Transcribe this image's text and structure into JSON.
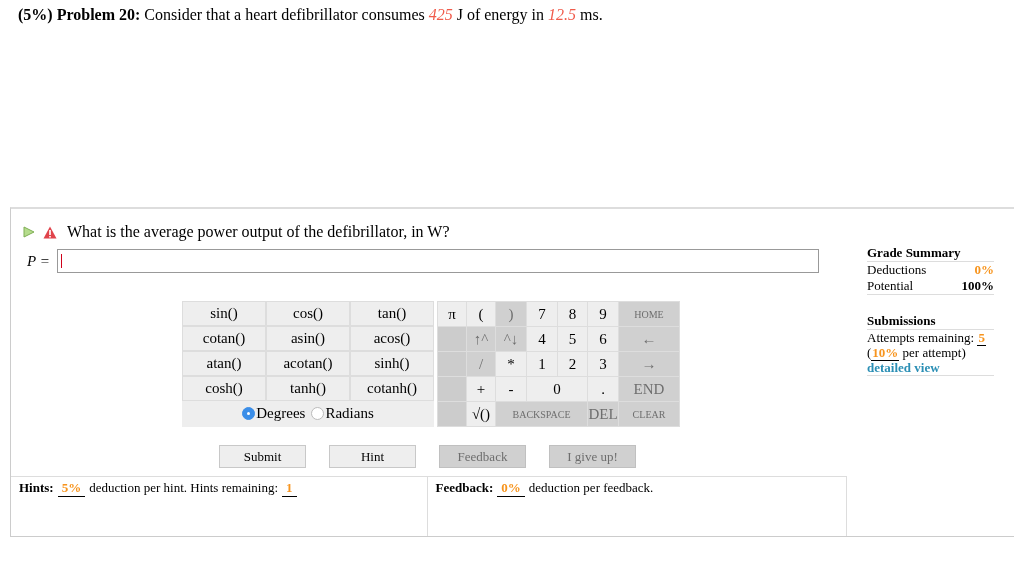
{
  "problem": [
    {
      "kind": "label",
      "text": "(5%) Problem 20:"
    },
    {
      "kind": "plain",
      "text": "Consider that a heart defibrillator consumes"
    },
    {
      "kind": "value",
      "text": "425"
    },
    {
      "kind": "plain",
      "text": "J of energy in"
    },
    {
      "kind": "value",
      "text": "12.5"
    },
    {
      "kind": "plain",
      "text": "ms."
    }
  ],
  "question": {
    "text": "What is the average power output of the defibrillator, in W?",
    "variable": "P ="
  },
  "functions": [
    [
      "sin()",
      "cos()",
      "tan()"
    ],
    [
      "cotan()",
      "asin()",
      "acos()"
    ],
    [
      "atan()",
      "acotan()",
      "sinh()"
    ],
    [
      "cosh()",
      "tanh()",
      "cotanh()"
    ]
  ],
  "angle_modes": [
    {
      "label": "Degrees",
      "selected": true
    },
    {
      "label": "Radians",
      "selected": false
    }
  ],
  "keypad": [
    [
      {
        "kind": "key",
        "label": "π",
        "disabled": false
      },
      {
        "kind": "key",
        "label": "(",
        "disabled": false
      },
      {
        "kind": "key",
        "label": ")",
        "disabled": true
      },
      {
        "kind": "key",
        "label": "7",
        "disabled": false
      },
      {
        "kind": "key",
        "label": "8",
        "disabled": false
      },
      {
        "kind": "key",
        "label": "9",
        "disabled": false
      },
      {
        "kind": "key",
        "label": "HOME",
        "disabled": true
      }
    ],
    [
      {
        "kind": "blank"
      },
      {
        "kind": "key",
        "label": "↑^",
        "disabled": true
      },
      {
        "kind": "key",
        "label": "^↓",
        "disabled": true
      },
      {
        "kind": "key",
        "label": "4",
        "disabled": false
      },
      {
        "kind": "key",
        "label": "5",
        "disabled": false
      },
      {
        "kind": "key",
        "label": "6",
        "disabled": false
      },
      {
        "kind": "key",
        "label": "←",
        "disabled": true
      }
    ],
    [
      {
        "kind": "blank"
      },
      {
        "kind": "key",
        "label": "/",
        "disabled": true
      },
      {
        "kind": "key",
        "label": "*",
        "disabled": false
      },
      {
        "kind": "key",
        "label": "1",
        "disabled": false
      },
      {
        "kind": "key",
        "label": "2",
        "disabled": false
      },
      {
        "kind": "key",
        "label": "3",
        "disabled": false
      },
      {
        "kind": "key",
        "label": "→",
        "disabled": true
      }
    ],
    [
      {
        "kind": "blank"
      },
      {
        "kind": "key",
        "label": "+",
        "disabled": false
      },
      {
        "kind": "key",
        "label": "-",
        "disabled": false
      },
      {
        "kind": "wide2",
        "label": "0",
        "disabled": false
      },
      {
        "kind": "key",
        "label": ".",
        "disabled": false
      },
      {
        "kind": "key",
        "label": "END",
        "disabled": true
      }
    ],
    [
      {
        "kind": "blank"
      },
      {
        "kind": "key",
        "label": "√()",
        "disabled": false
      },
      {
        "kind": "wide3",
        "label": "BACKSPACE",
        "disabled": true
      },
      {
        "kind": "key",
        "label": "DEL",
        "disabled": true
      },
      {
        "kind": "key",
        "label": "CLEAR",
        "disabled": true
      }
    ]
  ],
  "buttons": [
    {
      "label": "Submit",
      "disabled": false
    },
    {
      "label": "Hint",
      "disabled": false
    },
    {
      "label": "Feedback",
      "disabled": true
    },
    {
      "label": "I give up!",
      "disabled": true
    }
  ],
  "hints": {
    "label": "Hints:",
    "deduction": "5%",
    "text": "deduction per hint. Hints remaining:",
    "remaining": "1"
  },
  "feedback": {
    "label": "Feedback:",
    "deduction": "0%",
    "text": "deduction per feedback."
  },
  "grade_summary": {
    "title": "Grade Summary",
    "rows": [
      {
        "label": "Deductions",
        "value": "0%",
        "kind": "deduction"
      },
      {
        "label": "Potential",
        "value": "100%",
        "kind": "total"
      }
    ]
  },
  "submissions": {
    "title": "Submissions",
    "attempts_label": "Attempts remaining:",
    "attempts": "5",
    "open": "(",
    "per_attempt": "10%",
    "per_text": "per attempt)",
    "link": "detailed view"
  }
}
